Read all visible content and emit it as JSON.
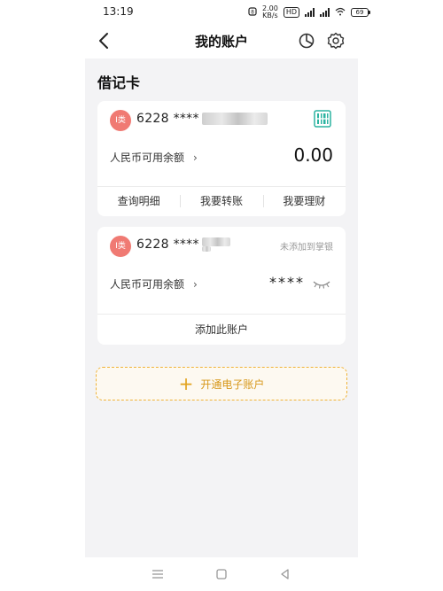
{
  "status_bar": {
    "time": "13:19",
    "speed_value": "2.00",
    "speed_unit": "KB/s",
    "hd_label": "HD",
    "battery": "69"
  },
  "header": {
    "title": "我的账户",
    "back_icon": "chevron-left-icon",
    "pie_icon": "pie-chart-icon",
    "settings_icon": "gear-icon"
  },
  "section": {
    "title": "借记卡"
  },
  "cards": [
    {
      "badge": "I类",
      "card_number": "6228 ****",
      "balance_label": "人民币可用余额",
      "balance_value": "0.00",
      "actions": [
        "查询明细",
        "我要转账",
        "我要理财"
      ]
    },
    {
      "badge": "I类",
      "card_number": "6228 ****",
      "status": "未添加到掌银",
      "balance_label": "人民币可用余额",
      "balance_value": "****",
      "add_label": "添加此账户"
    }
  ],
  "open_account": {
    "label": "开通电子账户"
  },
  "colors": {
    "accent": "#e2a21d",
    "badge": "#f07a73",
    "qr": "#2bb3a0",
    "background": "#f3f3f5"
  }
}
